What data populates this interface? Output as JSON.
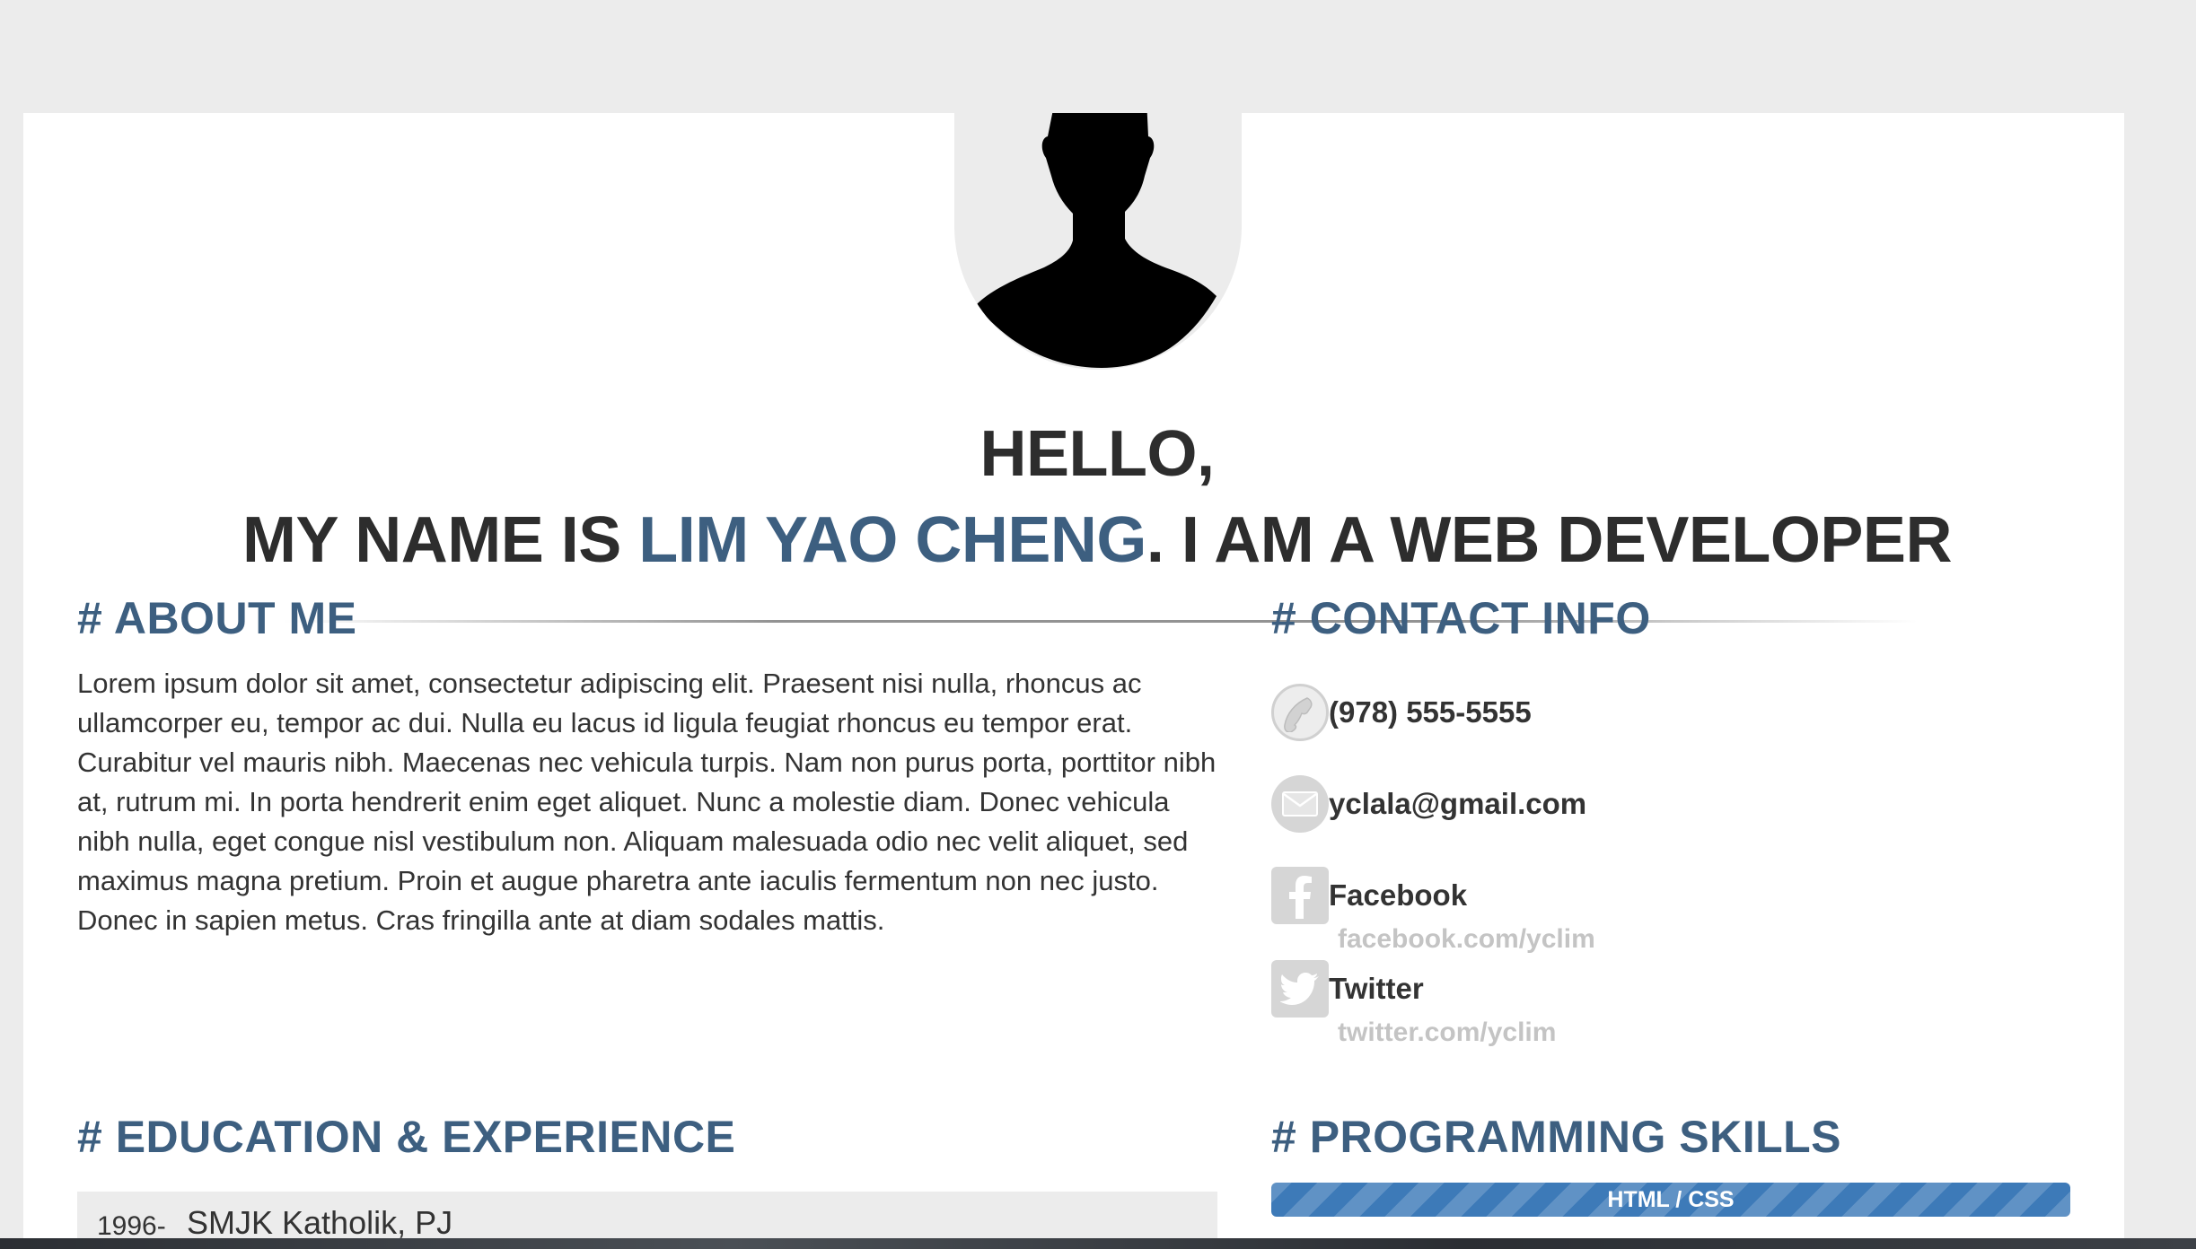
{
  "header": {
    "hello": "HELLO,",
    "intro_prefix": "MY NAME IS ",
    "name": "LIM YAO CHENG",
    "intro_suffix": ". I AM A WEB DEVELOPER"
  },
  "about": {
    "title": "# ABOUT ME",
    "text": "Lorem ipsum dolor sit amet, consectetur adipiscing elit. Praesent nisi nulla, rhoncus ac ullamcorper eu, tempor ac dui. Nulla eu lacus id ligula feugiat rhoncus eu tempor erat. Curabitur vel mauris nibh. Maecenas nec vehicula turpis. Nam non purus porta, porttitor nibh at, rutrum mi. In porta hendrerit enim eget aliquet. Nunc a molestie diam. Donec vehicula nibh nulla, eget congue nisl vestibulum non. Aliquam malesuada odio nec velit aliquet, sed maximus magna pretium. Proin et augue pharetra ante iaculis fermentum non nec justo. Donec in sapien metus. Cras fringilla ante at diam sodales mattis."
  },
  "contact": {
    "title": "# CONTACT INFO",
    "phone": "(978) 555-5555",
    "email": "yclala@gmail.com",
    "facebook_label": "Facebook",
    "facebook_url": "facebook.com/yclim",
    "twitter_label": "Twitter",
    "twitter_url": "twitter.com/yclim",
    "icons": [
      "phone-icon",
      "mail-icon",
      "facebook-icon",
      "twitter-icon"
    ]
  },
  "education": {
    "title": "# EDUCATION & EXPERIENCE",
    "items": [
      {
        "year": "1996-",
        "school": "SMJK Katholik, PJ"
      }
    ]
  },
  "skills": {
    "title": "# PROGRAMMING SKILLS",
    "items": [
      {
        "name": "HTML / CSS",
        "level": 1.0
      }
    ]
  },
  "colors": {
    "accent": "#3d5f80",
    "skill_bar": "#3d7ab8",
    "background": "#ececec",
    "muted_text": "#c4c4c4"
  }
}
